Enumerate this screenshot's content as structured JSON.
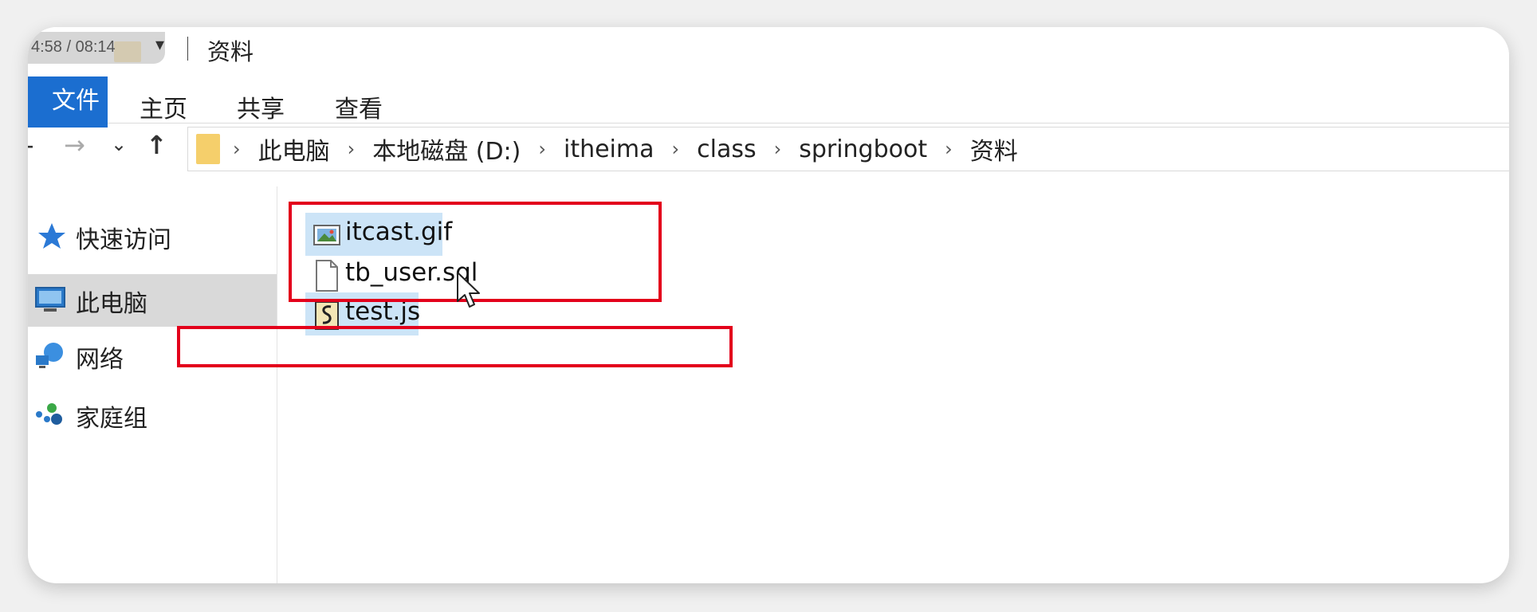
{
  "video": {
    "time": "4:58 / 08:14"
  },
  "window": {
    "title": "资料"
  },
  "ribbon": {
    "tabs": [
      {
        "label": "文件",
        "active": true
      },
      {
        "label": "主页"
      },
      {
        "label": "共享"
      },
      {
        "label": "查看"
      }
    ]
  },
  "nav": {
    "back_icon": "back-arrow-icon",
    "forward_icon": "forward-arrow-icon",
    "recent_icon": "chevron-down-icon",
    "up_icon": "up-arrow-icon",
    "breadcrumb": [
      "此电脑",
      "本地磁盘 (D:)",
      "itheima",
      "class",
      "springboot",
      "资料"
    ]
  },
  "sidebar": {
    "items": [
      {
        "label": "快速访问",
        "icon": "star-icon"
      },
      {
        "label": "此电脑",
        "icon": "computer-icon",
        "selected": true
      },
      {
        "label": "网络",
        "icon": "network-icon"
      },
      {
        "label": "家庭组",
        "icon": "homegroup-icon"
      }
    ]
  },
  "files": [
    {
      "name": "itcast.gif",
      "icon": "image-file-icon",
      "selected": true
    },
    {
      "name": "tb_user.sql",
      "icon": "text-file-icon"
    },
    {
      "name": "test.js",
      "icon": "script-file-icon",
      "selected": true
    }
  ],
  "colors": {
    "accent": "#1b6ed0",
    "selection": "#cce4f7",
    "annotation": "#e3001b"
  }
}
